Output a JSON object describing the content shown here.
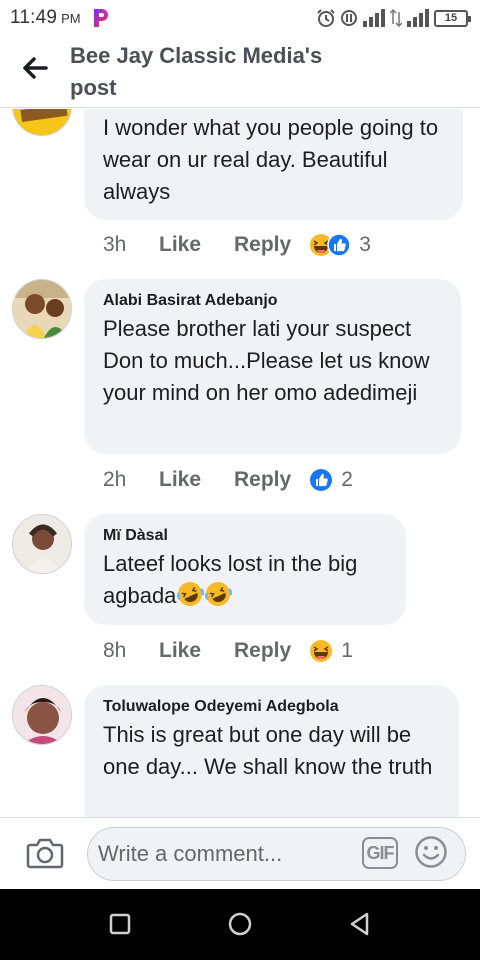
{
  "status_bar": {
    "time": "11:49",
    "ampm": "PM",
    "battery": "15"
  },
  "header": {
    "title": "Bee Jay Classic Media's post"
  },
  "comments": [
    {
      "author": "",
      "text": "I wonder what you people going to wear on ur real day. Beautiful always",
      "time": "3h",
      "like": "Like",
      "reply": "Reply",
      "reactions": [
        "laugh",
        "like"
      ],
      "reaction_count": "3"
    },
    {
      "author": "Alabi Basirat Adebanjo",
      "text": "Please brother lati your suspect Don to much...Please let us know your mind on her omo adedimeji",
      "time": "2h",
      "like": "Like",
      "reply": "Reply",
      "reactions": [
        "like"
      ],
      "reaction_count": "2"
    },
    {
      "author": "Mï Dàsal",
      "text": "Lateef looks lost in the big agbada",
      "time": "8h",
      "like": "Like",
      "reply": "Reply",
      "reactions": [
        "laugh"
      ],
      "reaction_count": "1"
    },
    {
      "author": "Toluwalope Odeyemi Adegbola",
      "text": "This is great but one day will be one day... We shall know the truth",
      "time": "",
      "like": "",
      "reply": "",
      "reactions": [],
      "reaction_count": ""
    }
  ],
  "composer": {
    "placeholder": "Write a comment...",
    "gif_label": "GIF"
  },
  "colors": {
    "bubble": "#f0f2f5",
    "like_blue": "#1877f2",
    "laugh_yellow": "#f7b928",
    "text_secondary": "#65676b"
  }
}
